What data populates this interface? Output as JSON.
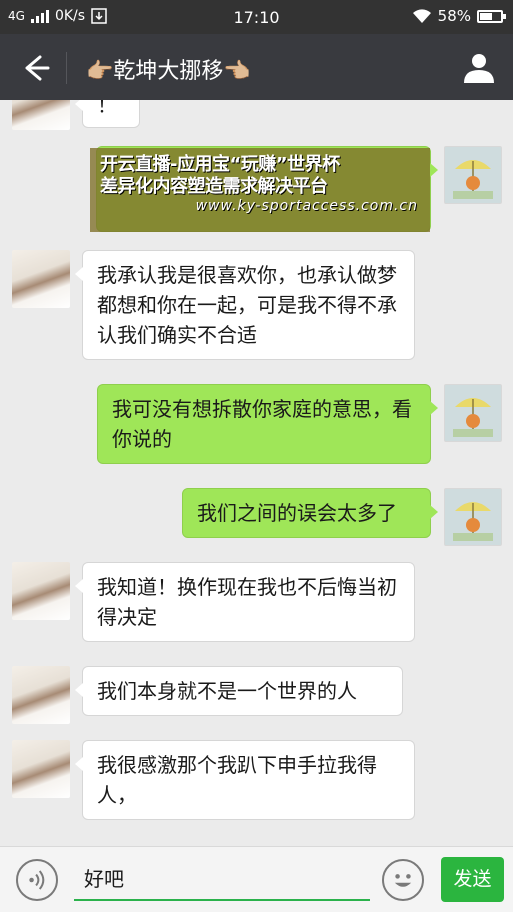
{
  "status_bar": {
    "network": "4G",
    "speed": "0K/s",
    "time": "17:10",
    "battery": "58%",
    "battery_level": 0.58
  },
  "header": {
    "title": "👉🏼乾坤大挪移👈🏼"
  },
  "watermark": {
    "line1": "开云直播-应用宝“玩赚”世界杯",
    "line2": "差异化内容塑造需求解决平台",
    "url": "www.ky-sportaccess.com.cn"
  },
  "messages": [
    {
      "side": "left",
      "text": "！"
    },
    {
      "side": "right",
      "text": ""
    },
    {
      "side": "left",
      "text": "我承认我是很喜欢你，也承认做梦都想和你在一起，可是我不得不承认我们确实不合适"
    },
    {
      "side": "right",
      "text": "我可没有想拆散你家庭的意思，看你说的"
    },
    {
      "side": "right",
      "text": "我们之间的误会太多了"
    },
    {
      "side": "left",
      "text": "我知道！换作现在我也不后悔当初得决定"
    },
    {
      "side": "left",
      "text": "我们本身就不是一个世界的人"
    },
    {
      "side": "left",
      "text": "我很感激那个我趴下申手拉我得人，"
    }
  ],
  "input_bar": {
    "text": "好吧",
    "send_label": "发送"
  },
  "colors": {
    "header_bg": "#393a3f",
    "bubble_right": "#9fe658",
    "send_button": "#2bb53f"
  },
  "icons": [
    "back-arrow-icon",
    "profile-icon",
    "voice-icon",
    "emoji-icon",
    "signal-icon",
    "wifi-icon",
    "battery-icon"
  ]
}
